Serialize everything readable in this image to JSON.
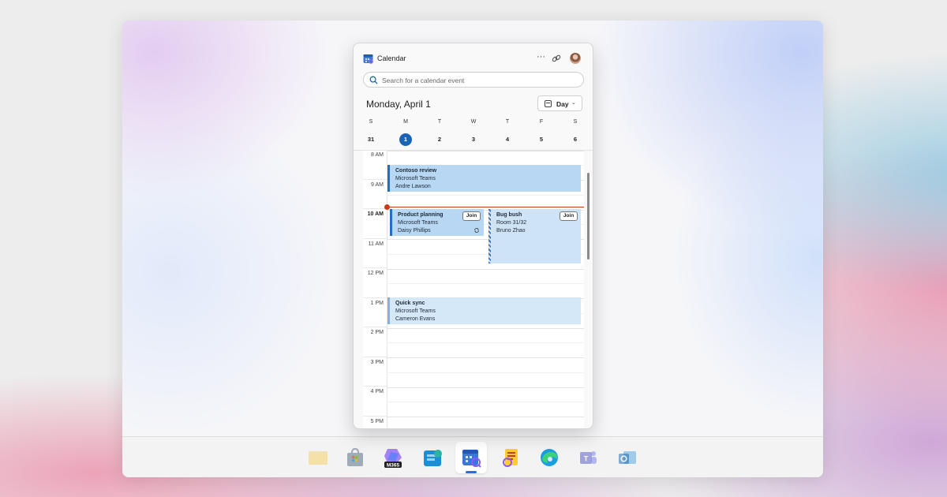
{
  "app": {
    "title": "Calendar",
    "more_icon": "more-icon",
    "link_icon": "link-icon"
  },
  "search": {
    "placeholder": "Search for a calendar event",
    "icon": "search-icon"
  },
  "header": {
    "date_title": "Monday, April 1",
    "view_label": "Day",
    "view_chevron": "⌄"
  },
  "week": {
    "days": [
      {
        "dow": "S",
        "date": "31"
      },
      {
        "dow": "M",
        "date": "1",
        "selected": true
      },
      {
        "dow": "T",
        "date": "2"
      },
      {
        "dow": "W",
        "date": "3"
      },
      {
        "dow": "T",
        "date": "4"
      },
      {
        "dow": "F",
        "date": "5"
      },
      {
        "dow": "S",
        "date": "6"
      }
    ]
  },
  "hours": [
    "8 AM",
    "9 AM",
    "10 AM",
    "11 AM",
    "12 PM",
    "1 PM",
    "2 PM",
    "3 PM",
    "4 PM",
    "5 PM"
  ],
  "events": {
    "contoso": {
      "title": "Contoso review",
      "location": "Microsoft Teams",
      "organizer": "Andre Lawson"
    },
    "product": {
      "title": "Product planning",
      "location": "Microsoft Teams",
      "organizer": "Daisy Phillips",
      "join_label": "Join"
    },
    "bug": {
      "title": "Bug bush",
      "location": "Room 31/32",
      "organizer": "Bruno Zhao",
      "join_label": "Join"
    },
    "quick": {
      "title": "Quick sync",
      "location": "Microsoft Teams",
      "organizer": "Cameron Evans"
    }
  },
  "taskbar": {
    "apps": [
      "file-explorer-icon",
      "store-icon",
      "m365-icon",
      "people-icon",
      "calendar-icon",
      "notes-icon",
      "edge-icon",
      "teams-icon",
      "outlook-icon"
    ],
    "m365_label": "M365"
  },
  "colors": {
    "accent": "#1b64b5",
    "now_line": "#c43e1c",
    "event_dark": "#b7d7f2",
    "event_light": "#d5e8f8"
  }
}
